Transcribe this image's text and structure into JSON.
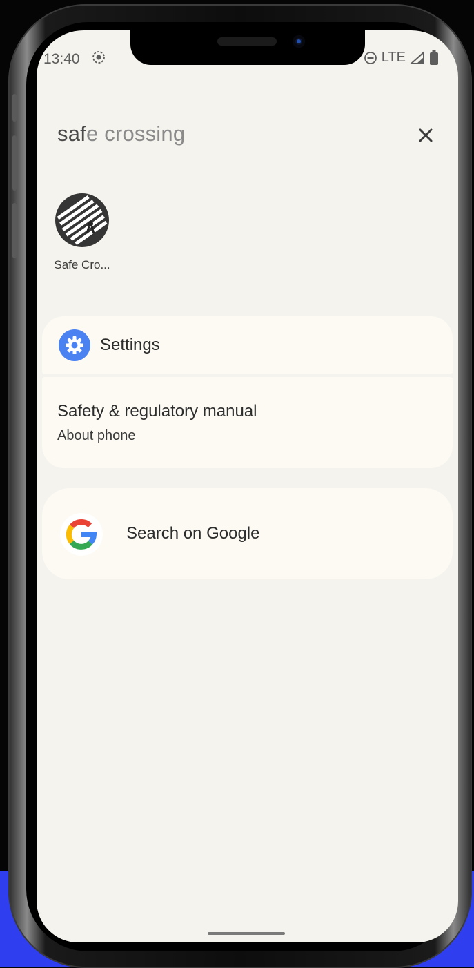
{
  "status_bar": {
    "time": "13:40",
    "network": "LTE",
    "icons": [
      "screen-record-icon",
      "dnd-icon",
      "signal-icon",
      "battery-icon"
    ]
  },
  "search": {
    "query_typed": "saf",
    "query_suggested": "e crossing",
    "close_icon": "close-icon"
  },
  "app_results": [
    {
      "label": "Safe Cro...",
      "icon": "safe-crossing-app-icon"
    }
  ],
  "settings_card": {
    "header": "Settings",
    "header_icon": "gear-icon",
    "item_title": "Safety & regulatory manual",
    "item_subtitle": "About phone"
  },
  "google_card": {
    "label": "Search on Google",
    "icon": "google-logo-icon"
  },
  "colors": {
    "screen_bg": "#f5f3ee",
    "card_bg": "#fcfaf3",
    "settings_blue": "#4a82f2",
    "backdrop_blue": "#2f3ff0"
  }
}
